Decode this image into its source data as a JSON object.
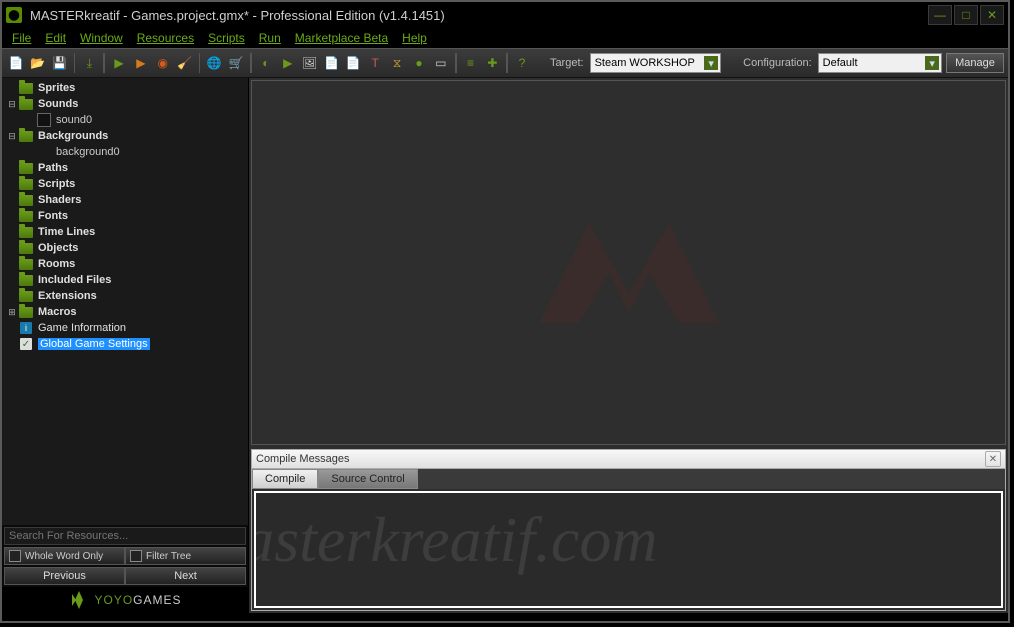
{
  "titlebar": {
    "title": "MASTERkreatif - Games.project.gmx*  -  Professional Edition (v1.4.1451)"
  },
  "menu": {
    "file": "File",
    "edit": "Edit",
    "window": "Window",
    "resources": "Resources",
    "scripts": "Scripts",
    "run": "Run",
    "marketplace": "Marketplace Beta",
    "help": "Help"
  },
  "toolbar": {
    "target_label": "Target:",
    "target_value": "Steam WORKSHOP",
    "config_label": "Configuration:",
    "config_value": "Default",
    "manage": "Manage"
  },
  "tree": {
    "sprites": "Sprites",
    "sounds": "Sounds",
    "sound0": "sound0",
    "backgrounds": "Backgrounds",
    "background0": "background0",
    "paths": "Paths",
    "scripts": "Scripts",
    "shaders": "Shaders",
    "fonts": "Fonts",
    "timelines": "Time Lines",
    "objects": "Objects",
    "rooms": "Rooms",
    "included": "Included Files",
    "extensions": "Extensions",
    "macros": "Macros",
    "gameinfo": "Game Information",
    "ggs": "Global Game Settings"
  },
  "search": {
    "placeholder": "Search For Resources...",
    "whole": "Whole Word Only",
    "filter": "Filter Tree",
    "prev": "Previous",
    "next": "Next"
  },
  "logo": {
    "yoyo": "YOYO",
    "games": "GAMES"
  },
  "compile": {
    "header": "Compile Messages",
    "tab1": "Compile",
    "tab2": "Source Control"
  },
  "watermark": "masterkreatif.com"
}
